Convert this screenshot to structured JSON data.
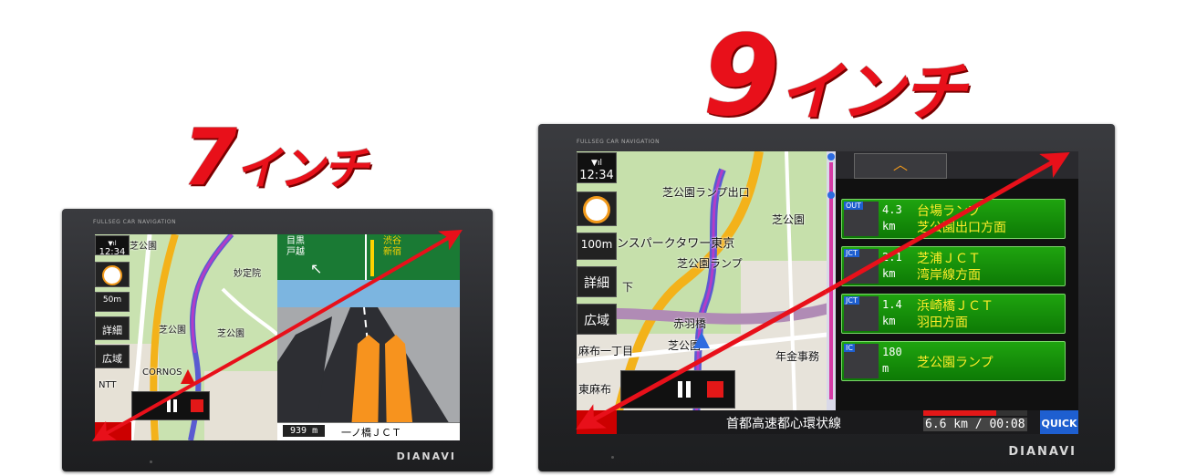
{
  "heading_7": {
    "number": "7",
    "unit": "インチ"
  },
  "heading_9": {
    "number": "9",
    "unit": "インチ"
  },
  "device_7": {
    "top_label": "FULLSEG CAR NAVIGATION",
    "logo": "DIANAVI",
    "clock": "12:34",
    "scale": "50m",
    "buttons": {
      "detail": "詳細",
      "wide": "広域"
    },
    "map_labels": [
      "芝公園",
      "妙定院",
      "芝公園",
      "芝公園",
      "CORNOS",
      "NTT"
    ],
    "sign_left": {
      "line1": "目黒",
      "line2": "戸越"
    },
    "sign_right": {
      "line1": "渋谷",
      "line2": "新宿"
    },
    "bottom_distance": "939 m",
    "bottom_name": "一ノ橋ＪＣＴ"
  },
  "device_9": {
    "top_label": "FULLSEG CAR NAVIGATION",
    "logo": "DIANAVI",
    "clock": "12:34",
    "scale": "100m",
    "buttons": {
      "detail": "詳細",
      "wide": "広域"
    },
    "map_labels": [
      "芝公園ランプ出口",
      "芝公園",
      "ンスパークタワー東京",
      "芝公園ランプ",
      "下",
      "赤羽橋",
      "麻布一丁目",
      "芝公園",
      "年金事務",
      "東麻布"
    ],
    "guides": [
      {
        "badge": "OUT",
        "dist": "4.3",
        "unit": "km",
        "name1": "台場ランプ",
        "name2": "芝公園出口方面"
      },
      {
        "badge": "JCT",
        "dist": "2.1",
        "unit": "km",
        "name1": "芝浦ＪＣＴ",
        "name2": "湾岸線方面"
      },
      {
        "badge": "JCT",
        "dist": "1.4",
        "unit": "km",
        "name1": "浜崎橋ＪＣＴ",
        "name2": "羽田方面"
      },
      {
        "badge": "IC",
        "dist": "180",
        "unit": "m",
        "name1": "芝公園ランプ",
        "name2": ""
      }
    ],
    "status_road": "首都高速都心環状線",
    "status_remain": "6.6 km / 00:08",
    "quick_label": "QUICK"
  }
}
